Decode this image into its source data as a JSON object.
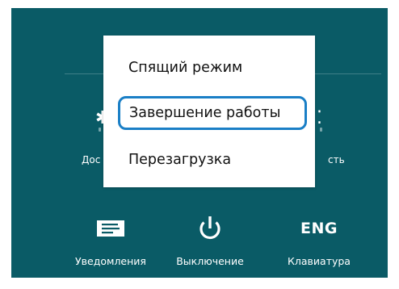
{
  "charms": {
    "row1": {
      "left_partial_label": "Дос",
      "right_partial_label": "сть"
    },
    "buttons": [
      {
        "icon": "notifications-icon",
        "label": "Уведомления"
      },
      {
        "icon": "power-icon",
        "label": "Выключение"
      },
      {
        "icon": "ENG",
        "label": "Клавиатура"
      }
    ]
  },
  "power_menu": {
    "items": [
      {
        "label": "Спящий режим",
        "selected": false
      },
      {
        "label": "Завершение работы",
        "selected": true
      },
      {
        "label": "Перезагрузка",
        "selected": false
      }
    ]
  },
  "colors": {
    "panel_background": "#0a5b66",
    "menu_background": "#ffffff",
    "selection_border": "#1a7fc6",
    "charm_text": "#ffffff"
  }
}
